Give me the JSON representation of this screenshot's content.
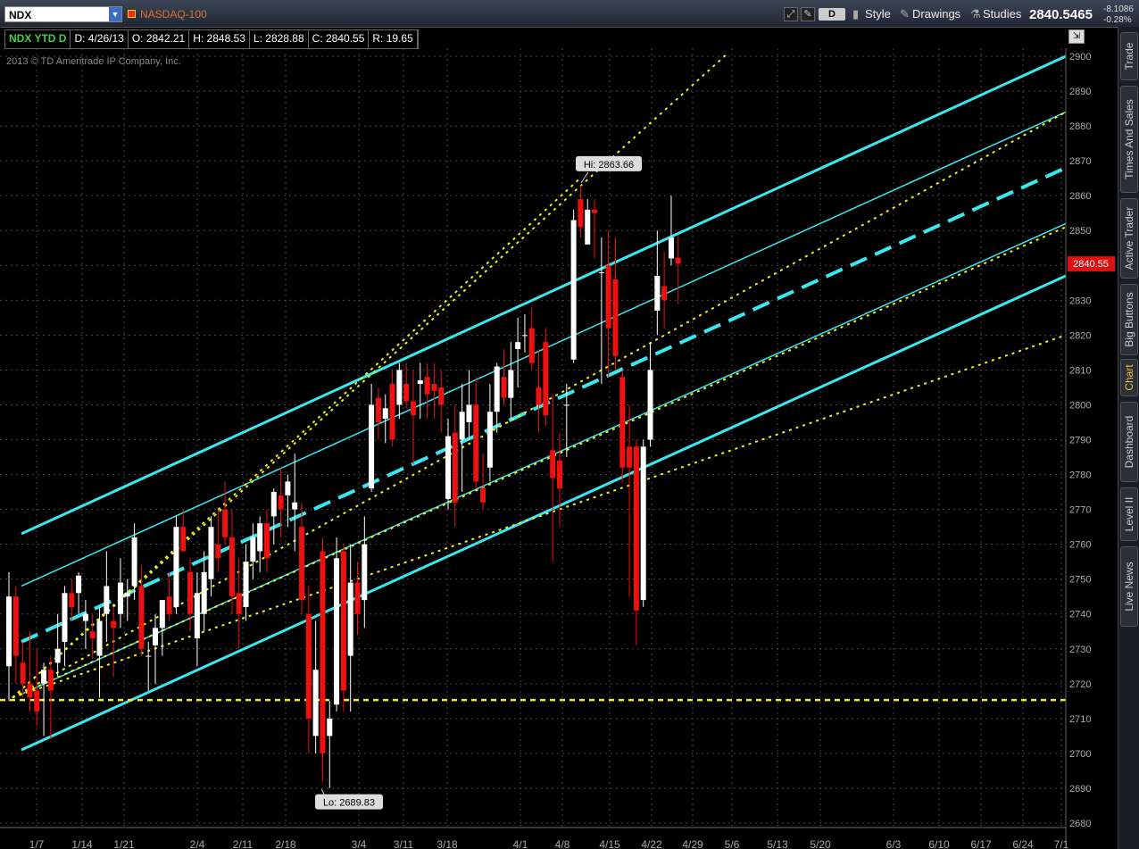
{
  "toolbar": {
    "symbol": "NDX",
    "index_name": "NASDAQ-100",
    "aggregation": "D",
    "style_label": "Style",
    "drawings_label": "Drawings",
    "studies_label": "Studies",
    "last_price": "2840.5465",
    "change_abs": "-8.1086",
    "change_pct": "-0.28%"
  },
  "info_bar": {
    "symbol_period": "NDX YTD D",
    "date": "D: 4/26/13",
    "open": "O: 2842.21",
    "high": "H: 2848.53",
    "low": "L: 2828.88",
    "close": "C: 2840.55",
    "range": "R: 19.65"
  },
  "copyright": "2013 © TD Ameritrade IP Company, Inc.",
  "right_tabs": [
    "Trade",
    "Times And Sales",
    "Active Trader",
    "Big Buttons",
    "Chart",
    "Dashboard",
    "Level II",
    "Live News"
  ],
  "active_tab": "Chart",
  "chart_data": {
    "type": "candlestick",
    "ylim": [
      2680,
      2900
    ],
    "y_ticks": [
      2680,
      2690,
      2700,
      2710,
      2720,
      2730,
      2740,
      2750,
      2760,
      2770,
      2780,
      2790,
      2800,
      2810,
      2820,
      2830,
      2840,
      2850,
      2860,
      2870,
      2880,
      2890,
      2900
    ],
    "x_ticks": [
      "1/7",
      "1/14",
      "1/21",
      "2/4",
      "2/11",
      "2/18",
      "3/4",
      "3/11",
      "3/18",
      "4/1",
      "4/8",
      "4/15",
      "4/22",
      "4/29",
      "5/6",
      "5/13",
      "5/20",
      "6/3",
      "6/10",
      "6/17",
      "6/24",
      "7/1"
    ],
    "candles": [
      {
        "o": 2725,
        "h": 2752,
        "l": 2715,
        "c": 2745
      },
      {
        "o": 2745,
        "h": 2748,
        "l": 2720,
        "c": 2728
      },
      {
        "o": 2726,
        "h": 2732,
        "l": 2716,
        "c": 2720
      },
      {
        "o": 2720,
        "h": 2735,
        "l": 2712,
        "c": 2716
      },
      {
        "o": 2718,
        "h": 2730,
        "l": 2708,
        "c": 2712
      },
      {
        "o": 2720,
        "h": 2726,
        "l": 2705,
        "c": 2724
      },
      {
        "o": 2724,
        "h": 2728,
        "l": 2704,
        "c": 2718
      },
      {
        "o": 2726,
        "h": 2740,
        "l": 2722,
        "c": 2730
      },
      {
        "o": 2732,
        "h": 2748,
        "l": 2725,
        "c": 2746
      },
      {
        "o": 2746,
        "h": 2750,
        "l": 2738,
        "c": 2742
      },
      {
        "o": 2746,
        "h": 2752,
        "l": 2740,
        "c": 2751
      },
      {
        "o": 2738,
        "h": 2744,
        "l": 2730,
        "c": 2740
      },
      {
        "o": 2735,
        "h": 2740,
        "l": 2727,
        "c": 2733
      },
      {
        "o": 2728,
        "h": 2742,
        "l": 2716,
        "c": 2738
      },
      {
        "o": 2740,
        "h": 2758,
        "l": 2732,
        "c": 2748
      },
      {
        "o": 2738,
        "h": 2742,
        "l": 2722,
        "c": 2736
      },
      {
        "o": 2740,
        "h": 2756,
        "l": 2736,
        "c": 2749
      },
      {
        "o": 2745,
        "h": 2750,
        "l": 2738,
        "c": 2746
      },
      {
        "o": 2748,
        "h": 2766,
        "l": 2744,
        "c": 2762
      },
      {
        "o": 2748,
        "h": 2754,
        "l": 2728,
        "c": 2730
      },
      {
        "o": 2728,
        "h": 2732,
        "l": 2718,
        "c": 2728
      },
      {
        "o": 2731,
        "h": 2740,
        "l": 2720,
        "c": 2736
      },
      {
        "o": 2736,
        "h": 2744,
        "l": 2728,
        "c": 2744
      },
      {
        "o": 2745,
        "h": 2752,
        "l": 2738,
        "c": 2740
      },
      {
        "o": 2742,
        "h": 2768,
        "l": 2740,
        "c": 2765
      },
      {
        "o": 2765,
        "h": 2770,
        "l": 2758,
        "c": 2758
      },
      {
        "o": 2752,
        "h": 2756,
        "l": 2735,
        "c": 2740
      },
      {
        "o": 2733,
        "h": 2752,
        "l": 2725,
        "c": 2746
      },
      {
        "o": 2740,
        "h": 2758,
        "l": 2735,
        "c": 2752
      },
      {
        "o": 2750,
        "h": 2768,
        "l": 2745,
        "c": 2765
      },
      {
        "o": 2760,
        "h": 2770,
        "l": 2752,
        "c": 2756
      },
      {
        "o": 2770,
        "h": 2778,
        "l": 2760,
        "c": 2762
      },
      {
        "o": 2762,
        "h": 2770,
        "l": 2740,
        "c": 2745
      },
      {
        "o": 2746,
        "h": 2756,
        "l": 2730,
        "c": 2740
      },
      {
        "o": 2742,
        "h": 2760,
        "l": 2738,
        "c": 2755
      },
      {
        "o": 2755,
        "h": 2766,
        "l": 2750,
        "c": 2762
      },
      {
        "o": 2758,
        "h": 2768,
        "l": 2752,
        "c": 2766
      },
      {
        "o": 2766,
        "h": 2770,
        "l": 2752,
        "c": 2756
      },
      {
        "o": 2768,
        "h": 2776,
        "l": 2760,
        "c": 2775
      },
      {
        "o": 2774,
        "h": 2782,
        "l": 2762,
        "c": 2770
      },
      {
        "o": 2774,
        "h": 2780,
        "l": 2765,
        "c": 2778
      },
      {
        "o": 2770,
        "h": 2786,
        "l": 2758,
        "c": 2772
      },
      {
        "o": 2765,
        "h": 2772,
        "l": 2740,
        "c": 2744
      },
      {
        "o": 2740,
        "h": 2748,
        "l": 2700,
        "c": 2710
      },
      {
        "o": 2705,
        "h": 2738,
        "l": 2700,
        "c": 2724
      },
      {
        "o": 2758,
        "h": 2762,
        "l": 2692,
        "c": 2700
      },
      {
        "o": 2705,
        "h": 2715,
        "l": 2690,
        "c": 2710
      },
      {
        "o": 2714,
        "h": 2762,
        "l": 2712,
        "c": 2756
      },
      {
        "o": 2758,
        "h": 2760,
        "l": 2712,
        "c": 2718
      },
      {
        "o": 2728,
        "h": 2760,
        "l": 2712,
        "c": 2749
      },
      {
        "o": 2749,
        "h": 2755,
        "l": 2734,
        "c": 2740
      },
      {
        "o": 2744,
        "h": 2768,
        "l": 2736,
        "c": 2760
      },
      {
        "o": 2776,
        "h": 2806,
        "l": 2775,
        "c": 2800
      },
      {
        "o": 2802,
        "h": 2805,
        "l": 2790,
        "c": 2795
      },
      {
        "o": 2796,
        "h": 2803,
        "l": 2789,
        "c": 2799
      },
      {
        "o": 2806,
        "h": 2810,
        "l": 2788,
        "c": 2790
      },
      {
        "o": 2800,
        "h": 2812,
        "l": 2796,
        "c": 2810
      },
      {
        "o": 2806,
        "h": 2812,
        "l": 2799,
        "c": 2801
      },
      {
        "o": 2801,
        "h": 2810,
        "l": 2783,
        "c": 2797
      },
      {
        "o": 2806,
        "h": 2812,
        "l": 2796,
        "c": 2807
      },
      {
        "o": 2808,
        "h": 2812,
        "l": 2796,
        "c": 2803
      },
      {
        "o": 2806,
        "h": 2812,
        "l": 2796,
        "c": 2804
      },
      {
        "o": 2805,
        "h": 2810,
        "l": 2792,
        "c": 2800
      },
      {
        "o": 2773,
        "h": 2796,
        "l": 2770,
        "c": 2791
      },
      {
        "o": 2792,
        "h": 2800,
        "l": 2765,
        "c": 2772
      },
      {
        "o": 2790,
        "h": 2806,
        "l": 2775,
        "c": 2798
      },
      {
        "o": 2795,
        "h": 2810,
        "l": 2790,
        "c": 2800
      },
      {
        "o": 2800,
        "h": 2808,
        "l": 2776,
        "c": 2778
      },
      {
        "o": 2776,
        "h": 2786,
        "l": 2770,
        "c": 2772
      },
      {
        "o": 2782,
        "h": 2806,
        "l": 2778,
        "c": 2798
      },
      {
        "o": 2798,
        "h": 2812,
        "l": 2792,
        "c": 2811
      },
      {
        "o": 2808,
        "h": 2816,
        "l": 2800,
        "c": 2802
      },
      {
        "o": 2802,
        "h": 2818,
        "l": 2796,
        "c": 2810
      },
      {
        "o": 2816,
        "h": 2825,
        "l": 2805,
        "c": 2818
      },
      {
        "o": 2820,
        "h": 2826,
        "l": 2815,
        "c": 2820
      },
      {
        "o": 2822,
        "h": 2828,
        "l": 2810,
        "c": 2812
      },
      {
        "o": 2805,
        "h": 2816,
        "l": 2792,
        "c": 2800
      },
      {
        "o": 2818,
        "h": 2822,
        "l": 2794,
        "c": 2797
      },
      {
        "o": 2787,
        "h": 2803,
        "l": 2755,
        "c": 2779
      },
      {
        "o": 2784,
        "h": 2792,
        "l": 2765,
        "c": 2776
      },
      {
        "o": 2800,
        "h": 2806,
        "l": 2785,
        "c": 2800
      },
      {
        "o": 2813,
        "h": 2856,
        "l": 2812,
        "c": 2853
      },
      {
        "o": 2859,
        "h": 2863,
        "l": 2848,
        "c": 2851
      },
      {
        "o": 2846,
        "h": 2859,
        "l": 2848,
        "c": 2856
      },
      {
        "o": 2856,
        "h": 2859,
        "l": 2842,
        "c": 2855
      },
      {
        "o": 2838,
        "h": 2848,
        "l": 2806,
        "c": 2838
      },
      {
        "o": 2840,
        "h": 2850,
        "l": 2808,
        "c": 2822
      },
      {
        "o": 2836,
        "h": 2848,
        "l": 2810,
        "c": 2814
      },
      {
        "o": 2808,
        "h": 2810,
        "l": 2778,
        "c": 2782
      },
      {
        "o": 2788,
        "h": 2800,
        "l": 2745,
        "c": 2782
      },
      {
        "o": 2788,
        "h": 2790,
        "l": 2731,
        "c": 2741
      },
      {
        "o": 2744,
        "h": 2790,
        "l": 2742,
        "c": 2788
      },
      {
        "o": 2790,
        "h": 2818,
        "l": 2788,
        "c": 2810
      },
      {
        "o": 2827,
        "h": 2850,
        "l": 2820,
        "c": 2837
      },
      {
        "o": 2834,
        "h": 2844,
        "l": 2822,
        "c": 2830
      },
      {
        "o": 2842,
        "h": 2860,
        "l": 2840,
        "c": 2848
      },
      {
        "o": 2842.21,
        "h": 2848.53,
        "l": 2828.88,
        "c": 2840.55
      }
    ],
    "hi_label": "Hi: 2863.66",
    "lo_label": "Lo: 2689.83",
    "last_label": "2840.55"
  }
}
